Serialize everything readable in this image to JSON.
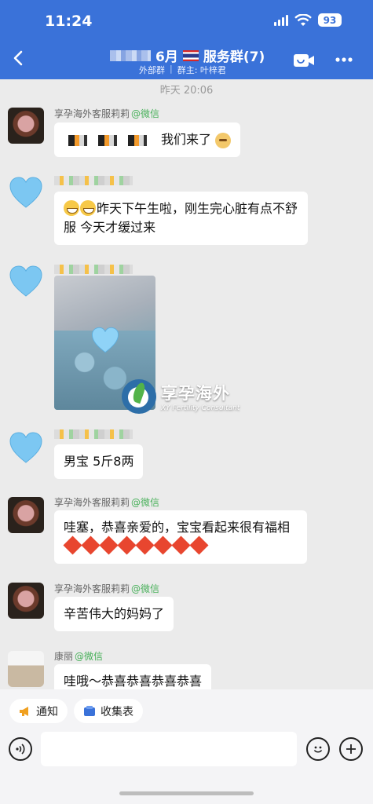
{
  "status_bar": {
    "time": "11:24",
    "battery": "93"
  },
  "header": {
    "title_month": "6月",
    "title_suffix": "服务群(7)",
    "subtitle_type": "外部群",
    "subtitle_owner": "群主: 叶梓君"
  },
  "timestamp": "昨天 20:06",
  "messages": [
    {
      "sender": "享孕海外客服莉莉",
      "tag": "@微信",
      "text": "我们来了"
    },
    {
      "text": "昨天下午生啦，刚生完心脏有点不舒服 今天才缓过来"
    },
    {
      "watermark_cn": "享孕海外",
      "watermark_en": "XY Fertility Consultant"
    },
    {
      "text": "男宝 5斤8两"
    },
    {
      "sender": "享孕海外客服莉莉",
      "tag": "@微信",
      "text": "哇塞，恭喜亲爱的，宝宝看起来很有福相"
    },
    {
      "sender": "享孕海外客服莉莉",
      "tag": "@微信",
      "text": "辛苦伟大的妈妈了"
    },
    {
      "sender": "康丽",
      "tag": "@微信",
      "text": "哇哦～恭喜恭喜恭喜恭喜"
    }
  ],
  "quick_actions": [
    {
      "label": "通知",
      "icon": "megaphone-icon"
    },
    {
      "label": "收集表",
      "icon": "form-icon"
    }
  ],
  "colors": {
    "header_bg": "#3a72d9",
    "wechat_tag": "#48b05a",
    "heart": "#7cc7f2"
  }
}
